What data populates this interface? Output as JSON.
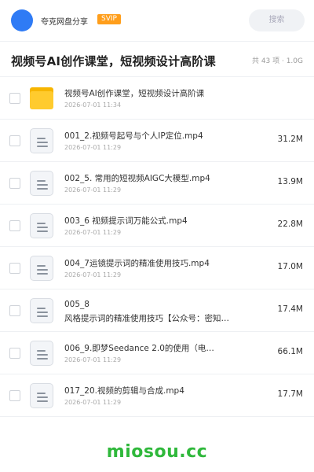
{
  "header": {
    "account_name": "夸克网盘分享",
    "badge": "SVIP",
    "search_placeholder": "搜索"
  },
  "title": {
    "text": "视频号AI创作课堂，短视频设计高阶课",
    "summary": "共 43 项 · 1.0G"
  },
  "files": [
    {
      "type": "folder",
      "name": "视频号AI创作课堂，短视频设计高阶课",
      "date": "2026-07-01 11:34",
      "size": ""
    },
    {
      "type": "file",
      "name": "001_2.视频号起号与个人IP定位.mp4",
      "date": "2026-07-01 11:29",
      "size": "31.2M"
    },
    {
      "type": "file",
      "name": "002_5. 常用的短视频AIGC大模型.mp4",
      "date": "2026-07-01 11:29",
      "size": "13.9M"
    },
    {
      "type": "file",
      "name": "003_6 视频提示词万能公式.mp4",
      "date": "2026-07-01 11:29",
      "size": "22.8M"
    },
    {
      "type": "file",
      "name": "004_7运镜提示词的精准使用技巧.mp4",
      "date": "2026-07-01 11:29",
      "size": "17.0M"
    },
    {
      "type": "file",
      "name": "005_8",
      "name_line2": "风格提示词的精准使用技巧【公众号：密知…",
      "date": "",
      "size": "17.4M"
    },
    {
      "type": "file",
      "name": "006_9.即梦Seedance 2.0的使用（电…",
      "date": "2026-07-01 11:29",
      "size": "66.1M"
    },
    {
      "type": "file",
      "name": "017_20.视频的剪辑与合成.mp4",
      "date": "2026-07-01 11:29",
      "size": "17.7M"
    }
  ],
  "footer": {
    "watermark": "miosou.cc"
  }
}
